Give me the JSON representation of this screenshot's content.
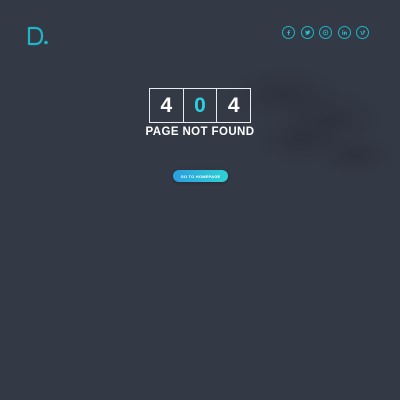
{
  "brand": {
    "logo_letter": "D",
    "accent_color": "#27c2d2"
  },
  "social": [
    {
      "name": "facebook",
      "glyph": "f"
    },
    {
      "name": "twitter",
      "glyph": "twitter"
    },
    {
      "name": "pinterest",
      "glyph": "p"
    },
    {
      "name": "linkedin",
      "glyph": "in"
    },
    {
      "name": "vimeo",
      "glyph": "v"
    }
  ],
  "error": {
    "digits": [
      "4",
      "0",
      "4"
    ],
    "title": "PAGE NOT FOUND"
  },
  "cta": {
    "label": "GO TO HOMEPAGE"
  },
  "colors": {
    "background": "#343946",
    "digit_accent": "#2bd0e0",
    "button_start": "#2a9ee0",
    "button_end": "#2ed2d2"
  }
}
